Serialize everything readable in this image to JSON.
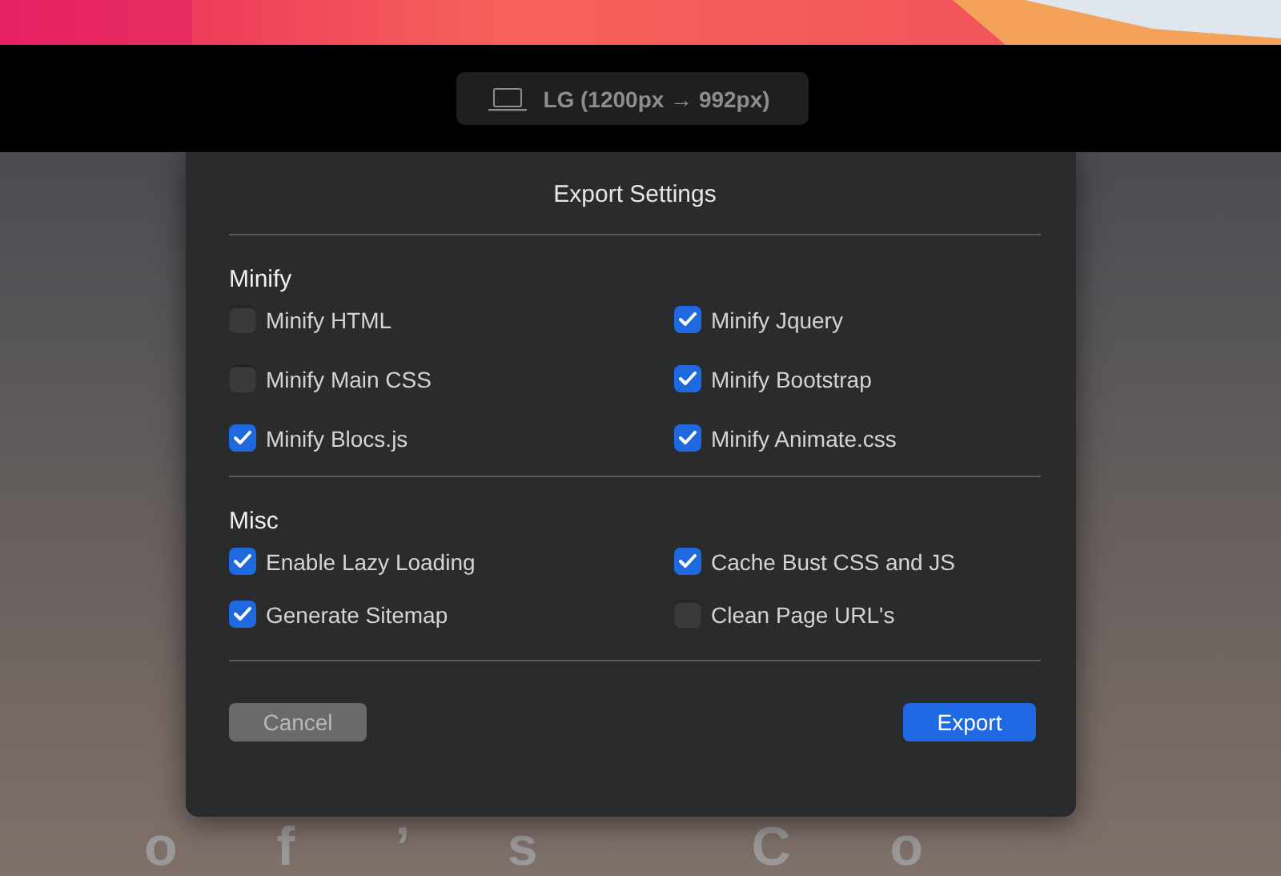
{
  "toolbar": {
    "device_label": "LG (1200px → 992px)"
  },
  "background_heading": "of’s Co",
  "dialog": {
    "title": "Export Settings",
    "sections": [
      {
        "title": "Minify",
        "options": [
          {
            "label": "Minify HTML",
            "checked": false
          },
          {
            "label": "Minify Jquery",
            "checked": true
          },
          {
            "label": "Minify Main CSS",
            "checked": false
          },
          {
            "label": "Minify Bootstrap",
            "checked": true
          },
          {
            "label": "Minify Blocs.js",
            "checked": true
          },
          {
            "label": "Minify Animate.css",
            "checked": true
          }
        ]
      },
      {
        "title": "Misc",
        "options": [
          {
            "label": "Enable Lazy Loading",
            "checked": true
          },
          {
            "label": "Cache Bust CSS and JS",
            "checked": true
          },
          {
            "label": "Generate Sitemap",
            "checked": true
          },
          {
            "label": "Clean Page URL's",
            "checked": false
          }
        ]
      }
    ],
    "buttons": [
      {
        "label": "Cancel",
        "kind": "secondary"
      },
      {
        "label": "Export",
        "kind": "primary"
      }
    ]
  }
}
